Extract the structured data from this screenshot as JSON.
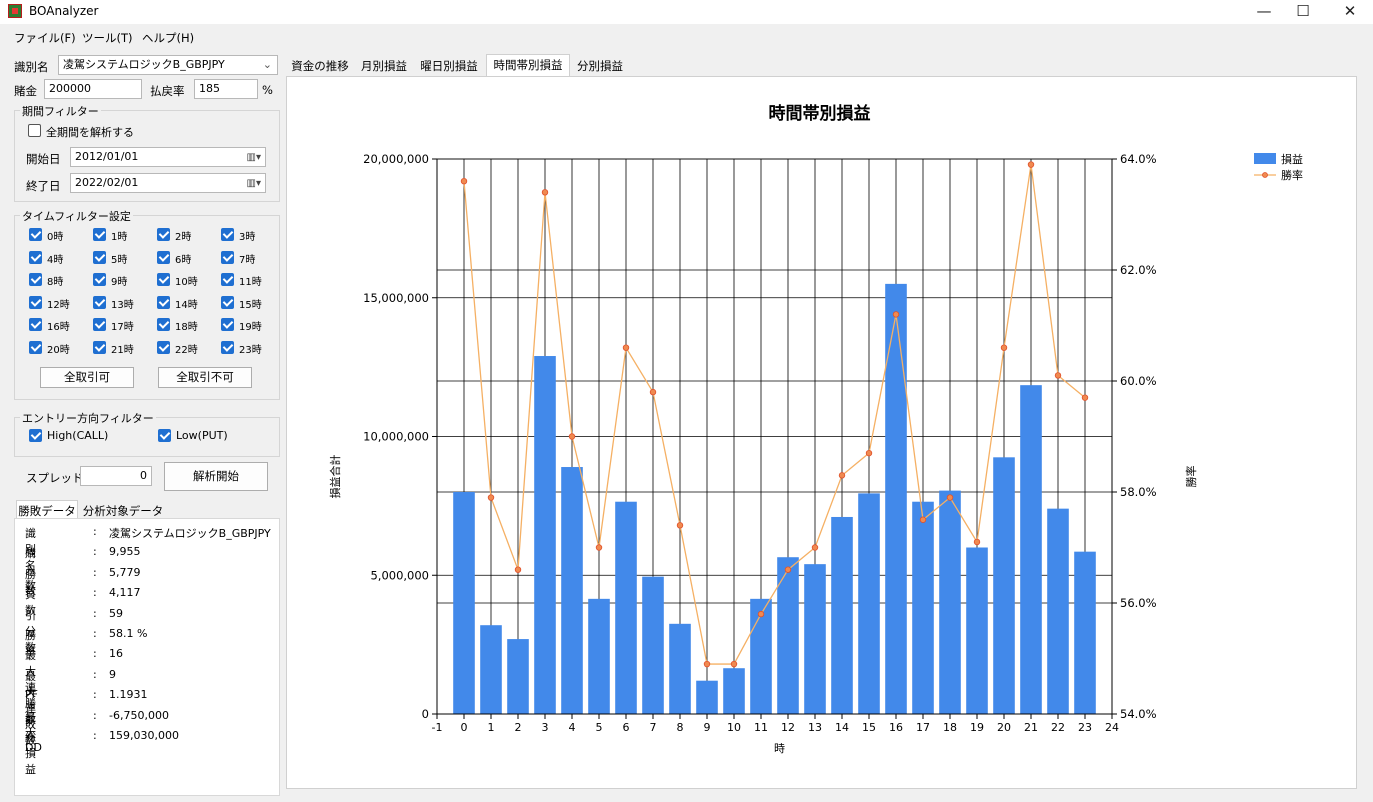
{
  "window": {
    "title": "BOAnalyzer",
    "minimize": "—",
    "maximize": "☐",
    "close": "✕"
  },
  "menu": [
    "ファイル(F)",
    "ツール(T)",
    "ヘルプ(H)"
  ],
  "form": {
    "id_label": "識別名",
    "id_value": "凌駕システムロジックB_GBPJPY",
    "stake_label": "賭金",
    "stake_value": "200000",
    "payout_label": "払戻率",
    "payout_value": "185",
    "payout_unit": "%"
  },
  "period_filter": {
    "title": "期間フィルター",
    "all_period_label": "全期間を解析する",
    "all_period_checked": false,
    "start_label": "開始日",
    "start_value": "2012/01/01",
    "end_label": "終了日",
    "end_value": "2022/02/01"
  },
  "time_filter": {
    "title": "タイムフィルター設定",
    "hours": [
      "0時",
      "1時",
      "2時",
      "3時",
      "4時",
      "5時",
      "6時",
      "7時",
      "8時",
      "9時",
      "10時",
      "11時",
      "12時",
      "13時",
      "14時",
      "15時",
      "16時",
      "17時",
      "18時",
      "19時",
      "20時",
      "21時",
      "22時",
      "23時"
    ],
    "allow_all_label": "全取引可",
    "deny_all_label": "全取引不可"
  },
  "direction_filter": {
    "title": "エントリー方向フィルター",
    "high_label": "High(CALL)",
    "low_label": "Low(PUT)"
  },
  "spread": {
    "label": "スプレッド",
    "value": "0",
    "analyze_label": "解析開始"
  },
  "bottom_tabs": [
    "勝敗データ",
    "分析対象データ"
  ],
  "results": [
    {
      "key": "識別名",
      "value": "凌駕システムロジックB_GBPJPY"
    },
    {
      "key": "購入数",
      "value": "9,955"
    },
    {
      "key": "勝数",
      "value": "5,779"
    },
    {
      "key": "負数",
      "value": "4,117"
    },
    {
      "key": "引分数",
      "value": "59"
    },
    {
      "key": "勝率",
      "value": "58.1 %"
    },
    {
      "key": "最大連勝数",
      "value": "16"
    },
    {
      "key": "最大連敗数",
      "value": "9"
    },
    {
      "key": "PF",
      "value": "1.1931"
    },
    {
      "key": "最大DD",
      "value": "-6,750,000"
    },
    {
      "key": "総損益",
      "value": "159,030,000"
    }
  ],
  "results_colon": ":",
  "chart_tabs": [
    "資金の推移",
    "月別損益",
    "曜日別損益",
    "時間帯別損益",
    "分別損益"
  ],
  "chart_tab_active": 3,
  "chart_data": {
    "type": "bar",
    "title": "時間帯別損益",
    "xlabel": "時",
    "ylabel": "損益合計",
    "y2label": "勝率",
    "x": [
      0,
      1,
      2,
      3,
      4,
      5,
      6,
      7,
      8,
      9,
      10,
      11,
      12,
      13,
      14,
      15,
      16,
      17,
      18,
      19,
      20,
      21,
      22,
      23
    ],
    "x_ticks": [
      -1,
      0,
      1,
      2,
      3,
      4,
      5,
      6,
      7,
      8,
      9,
      10,
      11,
      12,
      13,
      14,
      15,
      16,
      17,
      18,
      19,
      20,
      21,
      22,
      23,
      24
    ],
    "xlim": [
      -1,
      24
    ],
    "ylim": [
      0,
      20000000
    ],
    "y_ticks": [
      "0",
      "5,000,000",
      "10,000,000",
      "15,000,000",
      "20,000,000"
    ],
    "y_tick_values": [
      0,
      5000000,
      10000000,
      15000000,
      20000000
    ],
    "y2lim": [
      54,
      64
    ],
    "y2_ticks": [
      "54.0%",
      "56.0%",
      "58.0%",
      "60.0%",
      "62.0%",
      "64.0%"
    ],
    "y2_tick_values": [
      54,
      56,
      58,
      60,
      62,
      64
    ],
    "grid": true,
    "legend_position": "top-right",
    "series": [
      {
        "name": "損益",
        "kind": "bar",
        "axis": "left",
        "color": "#4289ea",
        "values": [
          8000000,
          3200000,
          2700000,
          12900000,
          8900000,
          4150000,
          7650000,
          4950000,
          3250000,
          1200000,
          1650000,
          4150000,
          5650000,
          5400000,
          7100000,
          7950000,
          15500000,
          7650000,
          8050000,
          6000000,
          9250000,
          11850000,
          7400000,
          5850000
        ]
      },
      {
        "name": "勝率",
        "kind": "line",
        "axis": "right",
        "color": "#f5b064",
        "values": [
          63.6,
          57.9,
          56.6,
          63.4,
          59.0,
          57.0,
          60.6,
          59.8,
          57.4,
          54.9,
          54.9,
          55.8,
          56.6,
          57.0,
          58.3,
          58.7,
          61.2,
          57.5,
          57.9,
          57.1,
          60.6,
          63.9,
          60.1,
          59.7
        ]
      }
    ]
  }
}
